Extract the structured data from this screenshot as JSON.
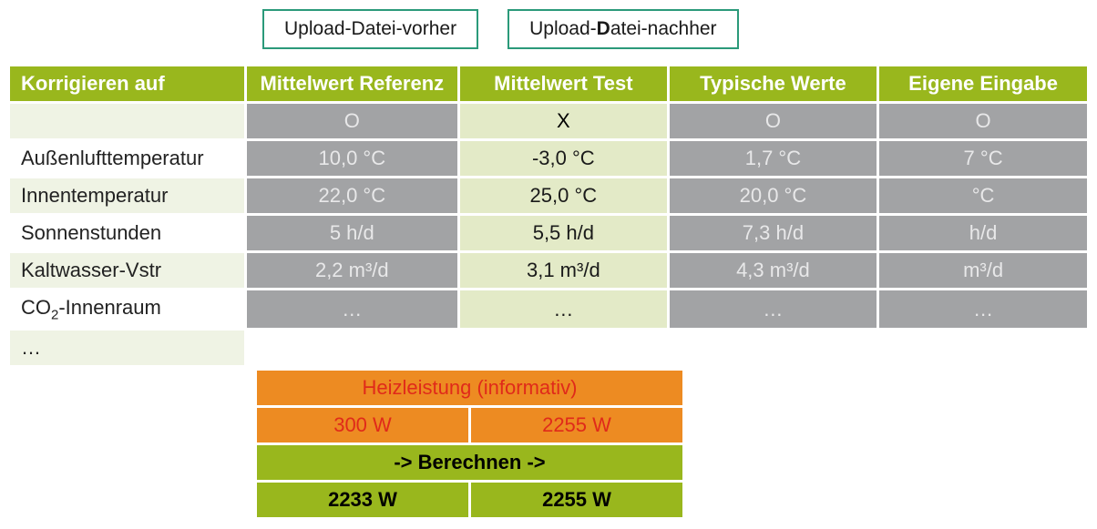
{
  "upload": {
    "before_pre": "Upload-Datei-vorher",
    "after_pre": "Upload-",
    "after_bold": "D",
    "after_post": "atei-nachher"
  },
  "headers": {
    "c0": "Korrigieren auf",
    "c1": "Mittelwert Referenz",
    "c2": "Mittelwert Test",
    "c3": "Typische Werte",
    "c4": "Eigene Eingabe"
  },
  "selector": {
    "c1": "O",
    "c2": "X",
    "c3": "O",
    "c4": "O"
  },
  "rows": [
    {
      "label": "Außenlufttemperatur",
      "c1": "10,0 °C",
      "c2": "-3,0 °C",
      "c3": "1,7 °C",
      "c4": "7  °C"
    },
    {
      "label": "Innentemperatur",
      "c1": "22,0 °C",
      "c2": "25,0 °C",
      "c3": "20,0 °C",
      "c4": "°C"
    },
    {
      "label": "Sonnenstunden",
      "c1": "5 h/d",
      "c2": "5,5 h/d",
      "c3": "7,3 h/d",
      "c4": "h/d"
    },
    {
      "label": "Kaltwasser-Vstr",
      "c1": "2,2 m³/d",
      "c2": "3,1 m³/d",
      "c3": "4,3 m³/d",
      "c4": "m³/d"
    },
    {
      "label_pre": "CO",
      "label_sub": "2",
      "label_post": "-Innenraum",
      "c1": "…",
      "c2": "…",
      "c3": "…",
      "c4": "…"
    },
    {
      "label": "…",
      "c1": "",
      "c2": "",
      "c3": "",
      "c4": ""
    }
  ],
  "bottom": {
    "heiz_title": "Heizleistung (informativ)",
    "heiz_c1": "300 W",
    "heiz_c2": "2255 W",
    "calc_title": "-> Berechnen ->",
    "calc_c1": "2233 W",
    "calc_c2": "2255 W"
  },
  "chart_data": {
    "type": "table",
    "columns": [
      "Korrigieren auf",
      "Mittelwert Referenz",
      "Mittelwert Test",
      "Typische Werte",
      "Eigene Eingabe"
    ],
    "selected_column": "Mittelwert Test",
    "rows": [
      [
        "Außenlufttemperatur",
        "10,0 °C",
        "-3,0 °C",
        "1,7 °C",
        "7  °C"
      ],
      [
        "Innentemperatur",
        "22,0 °C",
        "25,0 °C",
        "20,0 °C",
        "°C"
      ],
      [
        "Sonnenstunden",
        "5 h/d",
        "5,5 h/d",
        "7,3 h/d",
        "h/d"
      ],
      [
        "Kaltwasser-Vstr",
        "2,2 m³/d",
        "3,1 m³/d",
        "4,3 m³/d",
        "m³/d"
      ],
      [
        "CO2-Innenraum",
        "…",
        "…",
        "…",
        "…"
      ]
    ],
    "heizleistung_informativ": {
      "Mittelwert Referenz": "300 W",
      "Mittelwert Test": "2255 W"
    },
    "berechnen_result": {
      "Mittelwert Referenz": "2233 W",
      "Mittelwert Test": "2255 W"
    }
  }
}
